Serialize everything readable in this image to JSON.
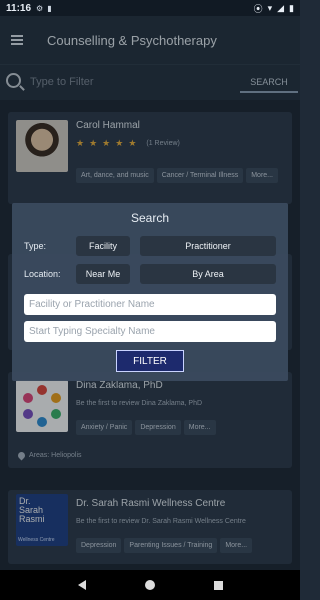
{
  "status": {
    "time": "11:16"
  },
  "header": {
    "title": "Counselling & Psychotherapy"
  },
  "search": {
    "placeholder": "Type to Filter",
    "button": "SEARCH"
  },
  "cards": [
    {
      "name": "Carol Hammal",
      "rating": 5,
      "reviews": "(1 Review)",
      "tags": [
        "Art, dance, and music",
        "Cancer / Terminal Illness",
        "More..."
      ]
    },
    {
      "name": "Dina Zaklama, PhD",
      "subtitle": "Be the first to review Dina Zaklama, PhD",
      "tags": [
        "Anxiety / Panic",
        "Depression",
        "More..."
      ],
      "areas": "Areas: Heliopolis"
    },
    {
      "name": "Dr. Sarah Rasmi Wellness Centre",
      "subtitle": "Be the first to review Dr. Sarah Rasmi Wellness Centre",
      "tags": [
        "Depression",
        "Parenting Issues / Training",
        "More..."
      ],
      "logo_text": [
        "Dr.",
        "Sarah",
        "Rasmi",
        "Wellness Centre"
      ]
    }
  ],
  "modal": {
    "title": "Search",
    "type_label": "Type:",
    "type_options": [
      "Facility",
      "Practitioner"
    ],
    "location_label": "Location:",
    "location_options": [
      "Near Me",
      "By Area"
    ],
    "name_placeholder": "Facility or Practitioner Name",
    "specialty_placeholder": "Start Typing Specialty Name",
    "filter_button": "FILTER"
  },
  "colors": {
    "accent": "#1d2a6d",
    "star": "#f0b23b",
    "background": "#1f2a37"
  }
}
